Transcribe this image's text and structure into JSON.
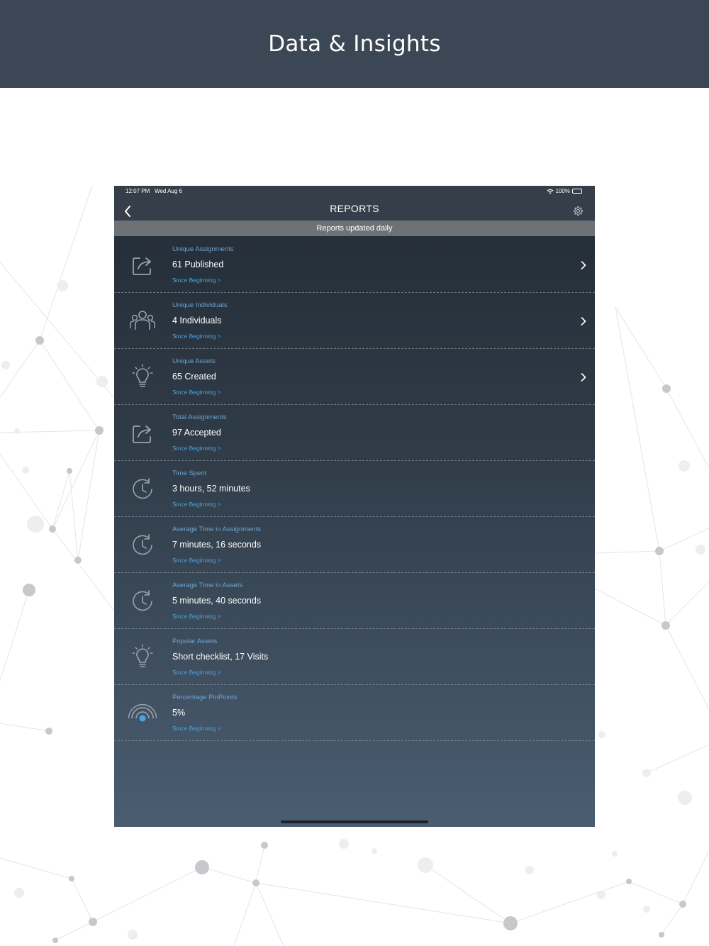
{
  "banner": {
    "title": "Data & Insights"
  },
  "status_bar": {
    "time": "12:07 PM",
    "date": "Wed Aug 6",
    "battery": "100%"
  },
  "nav": {
    "title": "REPORTS"
  },
  "subheader": {
    "text": "Reports updated daily"
  },
  "colors": {
    "banner": "#3b4754",
    "accent_label": "#6fa3cf",
    "link": "#4aa3e0",
    "background_top": "#232c36",
    "background_bottom": "#4a5d71"
  },
  "reports": [
    {
      "label": "Unique Assignments",
      "value": "61 Published",
      "since": "Since Beginning >",
      "icon": "share-icon",
      "has_chevron": true
    },
    {
      "label": "Unique Individuals",
      "value": "4 Individuals",
      "since": "Since Beginning >",
      "icon": "people-icon",
      "has_chevron": true
    },
    {
      "label": "Unique Assets",
      "value": "65 Created",
      "since": "Since Beginning >",
      "icon": "lightbulb-icon",
      "has_chevron": true
    },
    {
      "label": "Total Assignments",
      "value": "97 Accepted",
      "since": "Since Beginning >",
      "icon": "share-icon",
      "has_chevron": false
    },
    {
      "label": "Time Spent",
      "value": "3 hours, 52 minutes",
      "since": "Since Beginning >",
      "icon": "clock-icon",
      "has_chevron": false
    },
    {
      "label": "Average Time in Assignments",
      "value": "7 minutes, 16 seconds",
      "since": "Since Beginning >",
      "icon": "clock-icon",
      "has_chevron": false
    },
    {
      "label": "Average Time in Assets",
      "value": "5 minutes, 40 seconds",
      "since": "Since Beginning >",
      "icon": "clock-icon",
      "has_chevron": false
    },
    {
      "label": "Popular Assets",
      "value": "Short checklist, 17 Visits",
      "since": "Since Beginning >",
      "icon": "lightbulb-icon",
      "has_chevron": false
    },
    {
      "label": "Percentage PinPoints",
      "value": "5%",
      "since": "Since Beginning >",
      "icon": "pinpoint-signal-icon",
      "has_chevron": false
    }
  ]
}
